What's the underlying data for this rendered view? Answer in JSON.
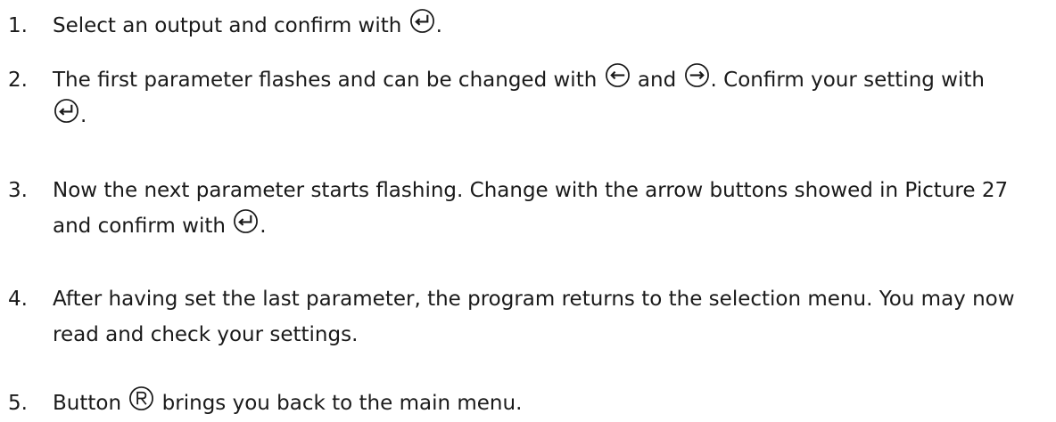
{
  "steps": [
    {
      "number": "1.",
      "text_a": "Select an output and confirm with",
      "icon_a": "enter-icon",
      "text_b": "."
    },
    {
      "number": "2.",
      "text_a": "The first parameter flashes and can be changed with",
      "icon_a": "arrow-left-icon",
      "text_b": "and",
      "icon_b": "arrow-right-icon",
      "text_c": ". Confirm your setting with",
      "icon_c": "enter-icon",
      "text_d": "."
    },
    {
      "number": "3.",
      "text_a": "Now the next parameter starts flashing. Change with the arrow buttons showed in Picture 27",
      "text_b": "and confirm with",
      "icon_a": "enter-icon",
      "text_c": "."
    },
    {
      "number": "4.",
      "text_a": "After having set the last parameter, the program returns to the selection menu. You may now",
      "text_b": "read and check your settings."
    },
    {
      "number": "5.",
      "text_a": "Button",
      "icon_a": "r-button-icon",
      "text_b": "brings you back to the main menu."
    }
  ]
}
